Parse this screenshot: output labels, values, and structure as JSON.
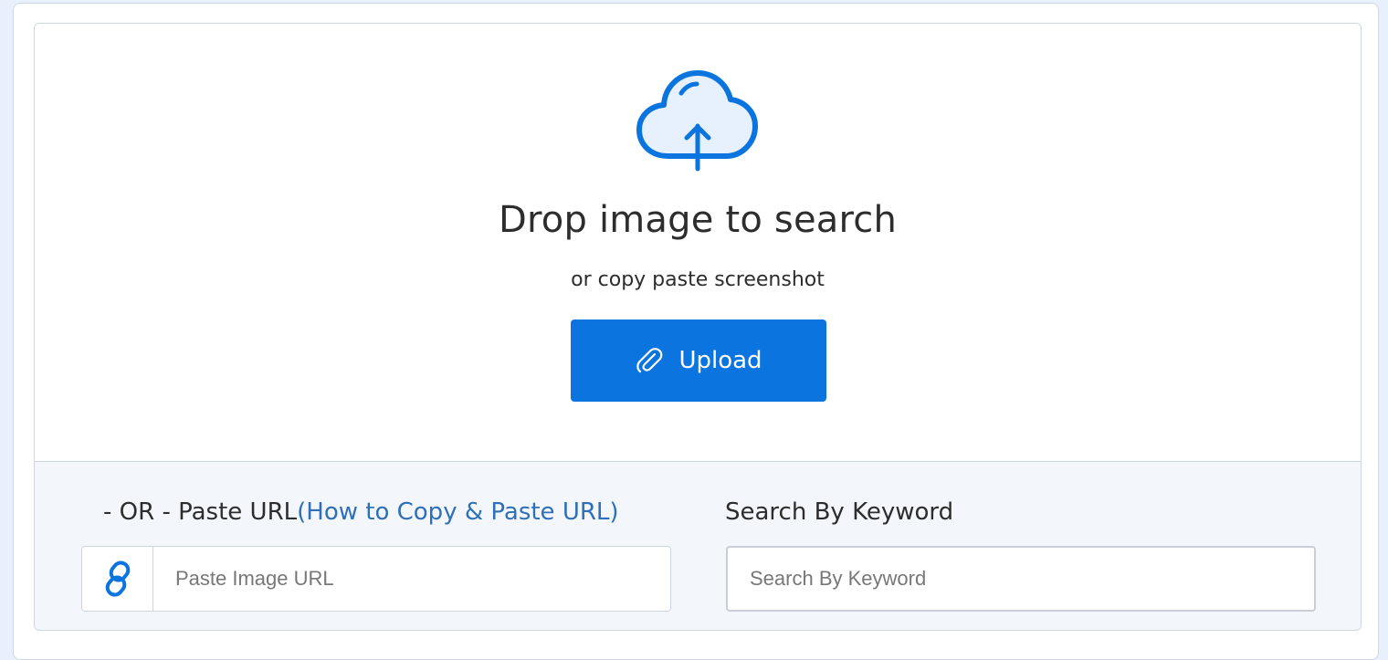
{
  "upload": {
    "icon": "cloud-upload-icon",
    "title": "Drop image to search",
    "subtitle": "or copy paste screenshot",
    "button_label": "Upload",
    "button_icon": "paperclip-icon"
  },
  "url_search": {
    "label_prefix": "- OR - Paste URL",
    "help_link": "(How to Copy & Paste URL)",
    "icon": "link-icon",
    "placeholder": "Paste Image URL",
    "value": ""
  },
  "keyword_search": {
    "label": "Search By Keyword",
    "placeholder": "Search By Keyword",
    "value": ""
  },
  "colors": {
    "accent": "#0b74de",
    "link": "#2f6fba",
    "background": "#e8f0fb"
  }
}
